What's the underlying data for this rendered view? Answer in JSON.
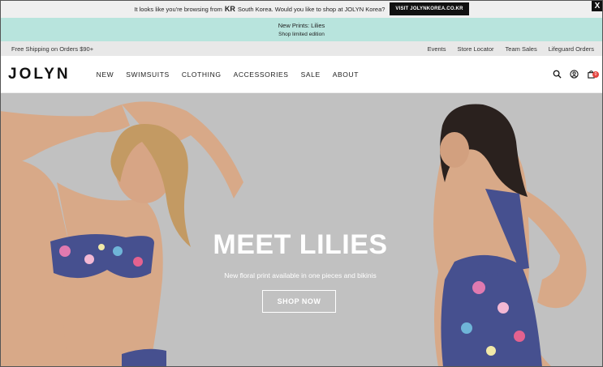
{
  "geo_banner": {
    "message_before": "It looks like you're browsing from",
    "country_code": "KR",
    "message_after": "South Korea. Would you like to shop at JOLYN Korea?",
    "button": "VISIT JOLYNKOREA.CO.KR",
    "close": "X"
  },
  "promo": {
    "line1": "New Prints: Lilies",
    "line2": "Shop limited edition"
  },
  "utility": {
    "shipping": "Free Shipping on Orders $90+",
    "links": [
      "Events",
      "Store Locator",
      "Team Sales",
      "Lifeguard Orders"
    ]
  },
  "nav": {
    "logo": "JOLYN",
    "menu": [
      "NEW",
      "SWIMSUITS",
      "CLOTHING",
      "ACCESSORIES",
      "SALE",
      "ABOUT"
    ],
    "cart_count": "0",
    "icons": [
      "search-icon",
      "account-icon",
      "bag-icon"
    ]
  },
  "hero": {
    "title": "MEET LILIES",
    "subtitle": "New floral print available in one pieces and bikinis",
    "cta": "SHOP NOW",
    "background": "#c1c1c1"
  }
}
